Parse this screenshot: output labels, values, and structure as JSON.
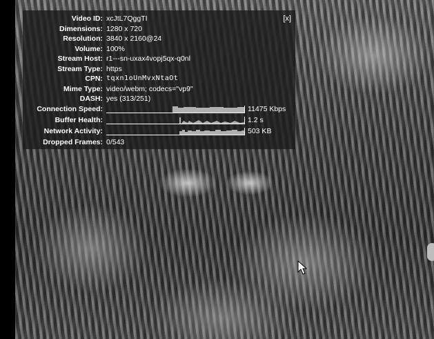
{
  "stats": {
    "close_label": "[x]",
    "rows": [
      {
        "label": "Video ID:",
        "value": "xcJtL7QggTI"
      },
      {
        "label": "Dimensions:",
        "value": "1280 x 720"
      },
      {
        "label": "Resolution:",
        "value": "3840 x 2160@24"
      },
      {
        "label": "Volume:",
        "value": "100%"
      },
      {
        "label": "Stream Host:",
        "value": "r1---sn-uxax4vopj5qx-q0nl"
      },
      {
        "label": "Stream Type:",
        "value": "https"
      },
      {
        "label": "CPN:",
        "value": "tqxn1oUnMvxNtaOt"
      },
      {
        "label": "Mime Type:",
        "value": "video/webm; codecs=\"vp9\""
      },
      {
        "label": "DASH:",
        "value": "yes (313/251)"
      }
    ],
    "graphs": [
      {
        "label": "Connection Speed:",
        "value": "11475 Kbps"
      },
      {
        "label": "Buffer Health:",
        "value": "1.2 s"
      },
      {
        "label": "Network Activity:",
        "value": "503 KB"
      }
    ],
    "dropped": {
      "label": "Dropped Frames:",
      "value": "0/543"
    }
  },
  "colors": {
    "panel_bg": "#1c1c1c",
    "graph_fill": "#b0b0b0",
    "text": "#ffffff"
  }
}
